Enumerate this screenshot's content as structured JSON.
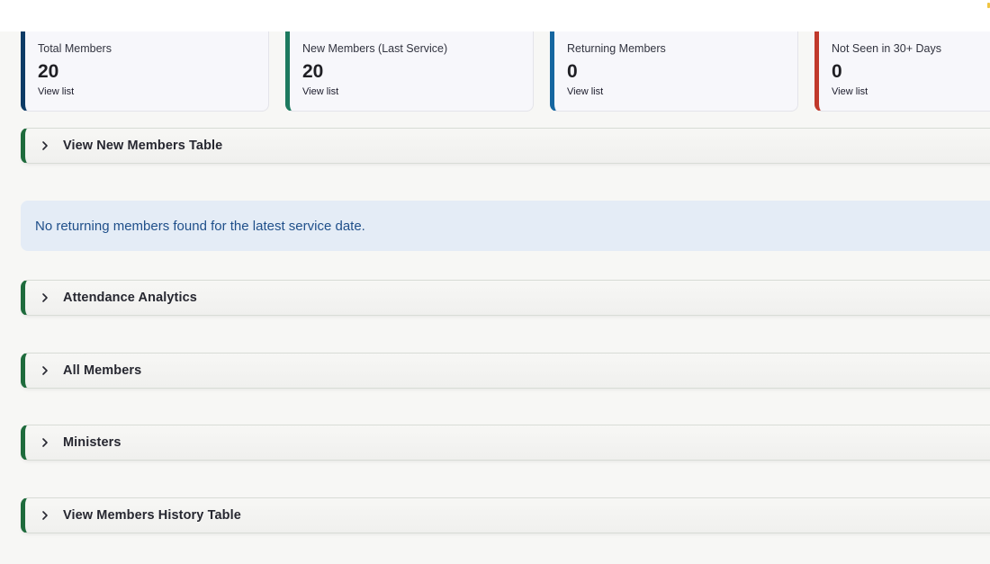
{
  "metrics": [
    {
      "label": "Total Members",
      "value": "20",
      "link": "View list"
    },
    {
      "label": "New Members (Last Service)",
      "value": "20",
      "link": "View list"
    },
    {
      "label": "Returning Members",
      "value": "0",
      "link": "View list"
    },
    {
      "label": "Not Seen in 30+ Days",
      "value": "0",
      "link": "View list"
    }
  ],
  "expanders": {
    "new_members_table": "View New Members Table",
    "attendance_analytics": "Attendance Analytics",
    "all_members": "All Members",
    "ministers": "Ministers",
    "members_history_table": "View Members History Table"
  },
  "info_message": "No returning members found for the latest service date.",
  "icons": {
    "expander": "chevron-right-icon"
  },
  "colors": {
    "total_accent": "#0d3b66",
    "new_accent": "#1d7a5f",
    "returning_accent": "#1566a0",
    "not_seen_accent": "#c0392b",
    "expander_accent": "#1e6b3c",
    "info_bg": "#e4ecf6",
    "info_text": "#1f4f8a"
  }
}
